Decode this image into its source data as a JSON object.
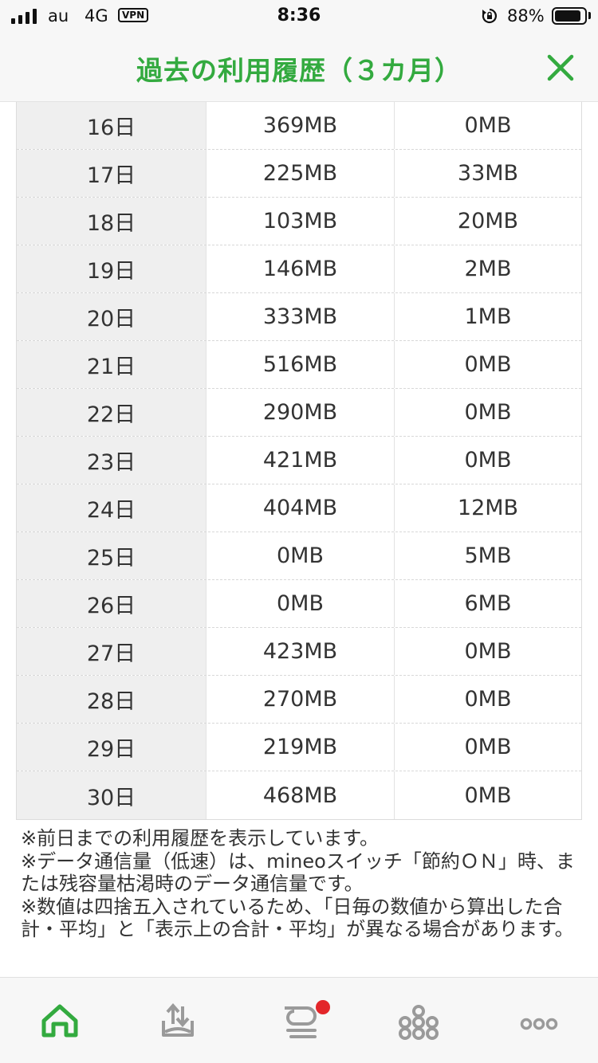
{
  "status_bar": {
    "carrier": "au",
    "network": "4G",
    "vpn": "VPN",
    "time": "8:36",
    "battery_percent": "88%",
    "battery_level": 0.88
  },
  "header": {
    "title": "過去の利用履歴（３カ月）",
    "close_icon": "close-icon",
    "accent_color": "#33aa3f"
  },
  "usage_table": {
    "rows": [
      {
        "day": "16日",
        "high_speed": "369MB",
        "low_speed": "0MB"
      },
      {
        "day": "17日",
        "high_speed": "225MB",
        "low_speed": "33MB"
      },
      {
        "day": "18日",
        "high_speed": "103MB",
        "low_speed": "20MB"
      },
      {
        "day": "19日",
        "high_speed": "146MB",
        "low_speed": "2MB"
      },
      {
        "day": "20日",
        "high_speed": "333MB",
        "low_speed": "1MB"
      },
      {
        "day": "21日",
        "high_speed": "516MB",
        "low_speed": "0MB"
      },
      {
        "day": "22日",
        "high_speed": "290MB",
        "low_speed": "0MB"
      },
      {
        "day": "23日",
        "high_speed": "421MB",
        "low_speed": "0MB"
      },
      {
        "day": "24日",
        "high_speed": "404MB",
        "low_speed": "12MB"
      },
      {
        "day": "25日",
        "high_speed": "0MB",
        "low_speed": "5MB"
      },
      {
        "day": "26日",
        "high_speed": "0MB",
        "low_speed": "6MB"
      },
      {
        "day": "27日",
        "high_speed": "423MB",
        "low_speed": "0MB"
      },
      {
        "day": "28日",
        "high_speed": "270MB",
        "low_speed": "0MB"
      },
      {
        "day": "29日",
        "high_speed": "219MB",
        "low_speed": "0MB"
      },
      {
        "day": "30日",
        "high_speed": "468MB",
        "low_speed": "0MB"
      }
    ]
  },
  "notes": [
    "※前日までの利用履歴を表示しています。",
    "※データ通信量（低速）は、mineoスイッチ「節約ＯＮ」時、または残容量枯渇時のデータ通信量です。",
    "※数値は四捨五入されているため、「日毎の数値から算出した合計・平均」と「表示上の合計・平均」が異なる場合があります。"
  ],
  "bottom_nav": {
    "items": [
      {
        "icon": "home-icon",
        "color": "#33aa3f",
        "active": true
      },
      {
        "icon": "upload-tray-icon",
        "color": "#9a9a9a",
        "active": false
      },
      {
        "icon": "chat-bubble-icon",
        "color": "#9a9a9a",
        "active": false,
        "badge": true
      },
      {
        "icon": "community-icon",
        "color": "#9a9a9a",
        "active": false
      },
      {
        "icon": "more-dots-icon",
        "color": "#9a9a9a",
        "active": false
      }
    ],
    "badge_color": "#e3262a"
  }
}
